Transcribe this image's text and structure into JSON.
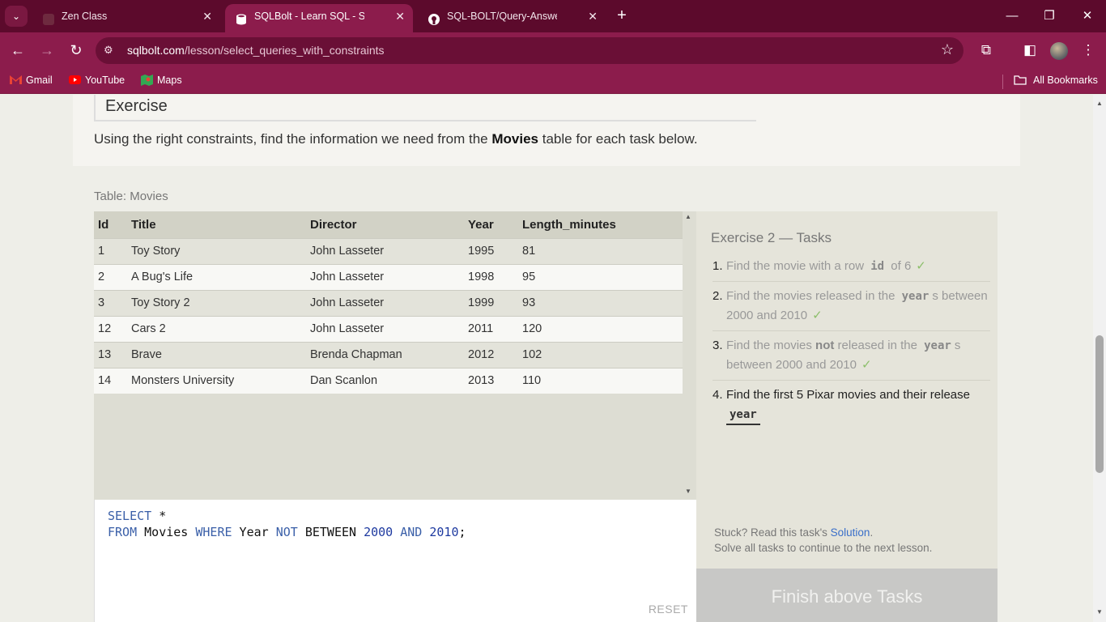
{
  "browser": {
    "tabs": [
      {
        "title": "Zen Class",
        "active": false
      },
      {
        "title": "SQLBolt - Learn SQL - SQL Lesson",
        "active": true
      },
      {
        "title": "SQL-BOLT/Query-Answers.sql at",
        "active": false
      }
    ],
    "address": {
      "domain": "sqlbolt.com",
      "path": "/lesson/select_queries_with_constraints"
    },
    "bookmarks": [
      "Gmail",
      "YouTube",
      "Maps"
    ],
    "all_bookmarks": "All Bookmarks"
  },
  "lesson": {
    "exercise_heading": "Exercise",
    "intro_before": "Using the right constraints, find the information we need from the ",
    "intro_bold": "Movies",
    "intro_after": " table for each task below."
  },
  "table": {
    "label": "Table: Movies",
    "columns": [
      "Id",
      "Title",
      "Director",
      "Year",
      "Length_minutes"
    ],
    "rows": [
      [
        "1",
        "Toy Story",
        "John Lasseter",
        "1995",
        "81"
      ],
      [
        "2",
        "A Bug's Life",
        "John Lasseter",
        "1998",
        "95"
      ],
      [
        "3",
        "Toy Story 2",
        "John Lasseter",
        "1999",
        "93"
      ],
      [
        "12",
        "Cars 2",
        "John Lasseter",
        "2011",
        "120"
      ],
      [
        "13",
        "Brave",
        "Brenda Chapman",
        "2012",
        "102"
      ],
      [
        "14",
        "Monsters University",
        "Dan Scanlon",
        "2013",
        "110"
      ]
    ]
  },
  "editor": {
    "line1": {
      "kw1": "SELECT",
      "rest": " *"
    },
    "line2": {
      "kw1": "FROM",
      "t1": " Movies ",
      "kw2": "WHERE",
      "t2": " Year ",
      "kw3": "NOT",
      "t3": " BETWEEN ",
      "n1": "2000",
      "t4": " ",
      "kw4": "AND",
      "t5": " ",
      "n2": "2010",
      "t6": ";"
    },
    "reset_label": "RESET"
  },
  "tasks": {
    "title": "Exercise 2 — Tasks",
    "items": [
      {
        "num": "1.",
        "before": "Find the movie with a row ",
        "code": "id",
        "after": " of 6",
        "done": true
      },
      {
        "num": "2.",
        "before": "Find the movies released in the ",
        "code": "year",
        "after": "s between 2000 and 2010",
        "done": true
      },
      {
        "num": "3.",
        "before": "Find the movies ",
        "bold": "not",
        "middle": " released in the ",
        "code": "year",
        "after": "s between 2000 and 2010",
        "done": true
      },
      {
        "num": "4.",
        "before": "Find the first 5 Pixar movies and their release ",
        "code": "year",
        "after": "",
        "done": false
      }
    ],
    "check_mark": "✓",
    "stuck_before": "Stuck? Read this task's ",
    "stuck_link": "Solution",
    "stuck_after": ".",
    "continue_text": "Solve all tasks to continue to the next lesson.",
    "finish_label": "Finish above Tasks"
  }
}
